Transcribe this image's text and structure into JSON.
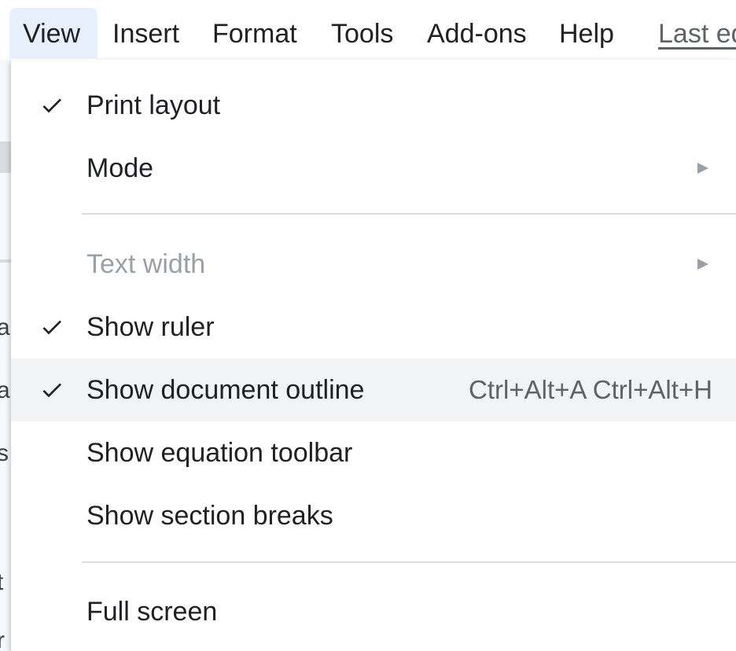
{
  "menubar": {
    "items": [
      "View",
      "Insert",
      "Format",
      "Tools",
      "Add-ons",
      "Help"
    ],
    "last_edit": "Last ed"
  },
  "background_fragments": [
    "a",
    "a",
    "s",
    "t",
    "r"
  ],
  "view_menu": {
    "print_layout": {
      "label": "Print layout",
      "checked": true
    },
    "mode": {
      "label": "Mode",
      "submenu": true
    },
    "text_width": {
      "label": "Text width",
      "submenu": true,
      "disabled": true
    },
    "show_ruler": {
      "label": "Show ruler",
      "checked": true
    },
    "show_document_outline": {
      "label": "Show document outline",
      "checked": true,
      "shortcut": "Ctrl+Alt+A Ctrl+Alt+H",
      "highlighted": true
    },
    "show_equation_toolbar": {
      "label": "Show equation toolbar"
    },
    "show_section_breaks": {
      "label": "Show section breaks"
    },
    "full_screen": {
      "label": "Full screen"
    }
  },
  "colors": {
    "active_menu_bg": "#e8f0fe",
    "hover_item_bg": "#f1f3f4",
    "text": "#202124",
    "disabled_text": "#9aa0a6",
    "shortcut_text": "#5f6368",
    "separator": "#dadce0"
  },
  "icons": {
    "check": "check-icon",
    "submenu": "submenu-arrow-icon"
  }
}
